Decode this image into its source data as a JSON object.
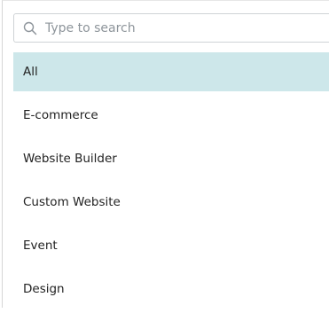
{
  "search": {
    "placeholder": "Type to search",
    "value": "",
    "icon": "search-icon"
  },
  "categories": {
    "selected_index": 0,
    "items": [
      {
        "label": "All"
      },
      {
        "label": "E-commerce"
      },
      {
        "label": "Website Builder"
      },
      {
        "label": "Custom Website"
      },
      {
        "label": "Event"
      },
      {
        "label": "Design"
      }
    ]
  },
  "colors": {
    "selected_background": "#cde7ea",
    "border": "#cfd3d6",
    "placeholder_text": "#8e959b"
  }
}
